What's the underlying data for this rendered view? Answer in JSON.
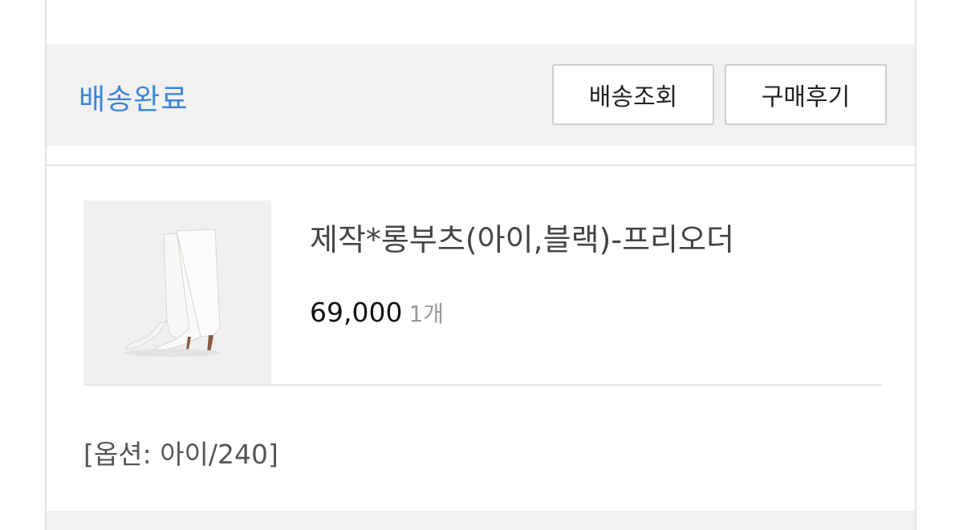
{
  "order": {
    "status": "배송완료",
    "buttons": {
      "track": "배송조회",
      "review": "구매후기"
    },
    "product": {
      "title": "제작*롱부츠(아이,블랙)-프리오더",
      "price": "69,000",
      "quantity": "1개",
      "option": "[옵션: 아이/240]",
      "image_icon": "white-knee-boots-image"
    }
  },
  "colors": {
    "status": "#3e86d9",
    "panel_bg": "#f1f1f1",
    "border": "#e2e2e2"
  }
}
